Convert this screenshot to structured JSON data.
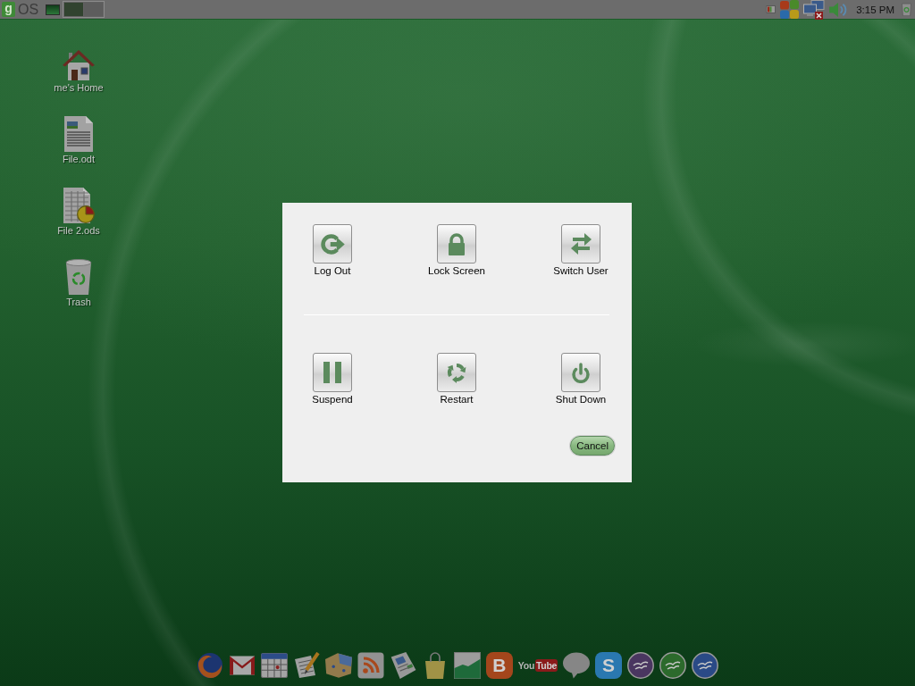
{
  "top_panel": {
    "menu": {
      "badge": "g",
      "text": "OS"
    },
    "workspaces": [
      {
        "selected": true
      },
      {
        "selected": false
      }
    ],
    "tray": [
      {
        "kind": "battery"
      },
      {
        "kind": "flag"
      },
      {
        "kind": "network"
      },
      {
        "kind": "speaker"
      }
    ],
    "clock": "3:15 PM"
  },
  "desktop_icons": [
    {
      "kind": "home",
      "label": "me's Home"
    },
    {
      "kind": "document",
      "label": "File.odt"
    },
    {
      "kind": "spreadsheet",
      "label": "File 2.ods"
    },
    {
      "kind": "trash",
      "label": "Trash"
    }
  ],
  "dialog": {
    "rows": [
      [
        {
          "kind": "log-out",
          "label": "Log Out"
        },
        {
          "kind": "lock",
          "label": "Lock Screen"
        },
        {
          "kind": "switch-user",
          "label": "Switch User"
        }
      ],
      [
        {
          "kind": "suspend",
          "label": "Suspend"
        },
        {
          "kind": "restart",
          "label": "Restart"
        },
        {
          "kind": "shut-down",
          "label": "Shut Down"
        }
      ]
    ],
    "cancel_button": "Cancel"
  },
  "dock": [
    {
      "kind": "globe"
    },
    {
      "kind": "mail"
    },
    {
      "kind": "calendar"
    },
    {
      "kind": "notepad"
    },
    {
      "kind": "letter-map"
    },
    {
      "kind": "feed"
    },
    {
      "kind": "newspaper"
    },
    {
      "kind": "bag"
    },
    {
      "kind": "chart"
    },
    {
      "kind": "letter",
      "text": "B",
      "color": "#a4461c"
    },
    {
      "kind": "wordmark",
      "text": "You",
      "boxed_text": "Tube"
    },
    {
      "kind": "bubble"
    },
    {
      "kind": "letter",
      "text": "S",
      "color": "#2a78b0"
    },
    {
      "kind": "gull",
      "color": "#4a3660"
    },
    {
      "kind": "gull",
      "color": "#2c6a2c"
    },
    {
      "kind": "gull",
      "color": "#2a4a86"
    }
  ]
}
